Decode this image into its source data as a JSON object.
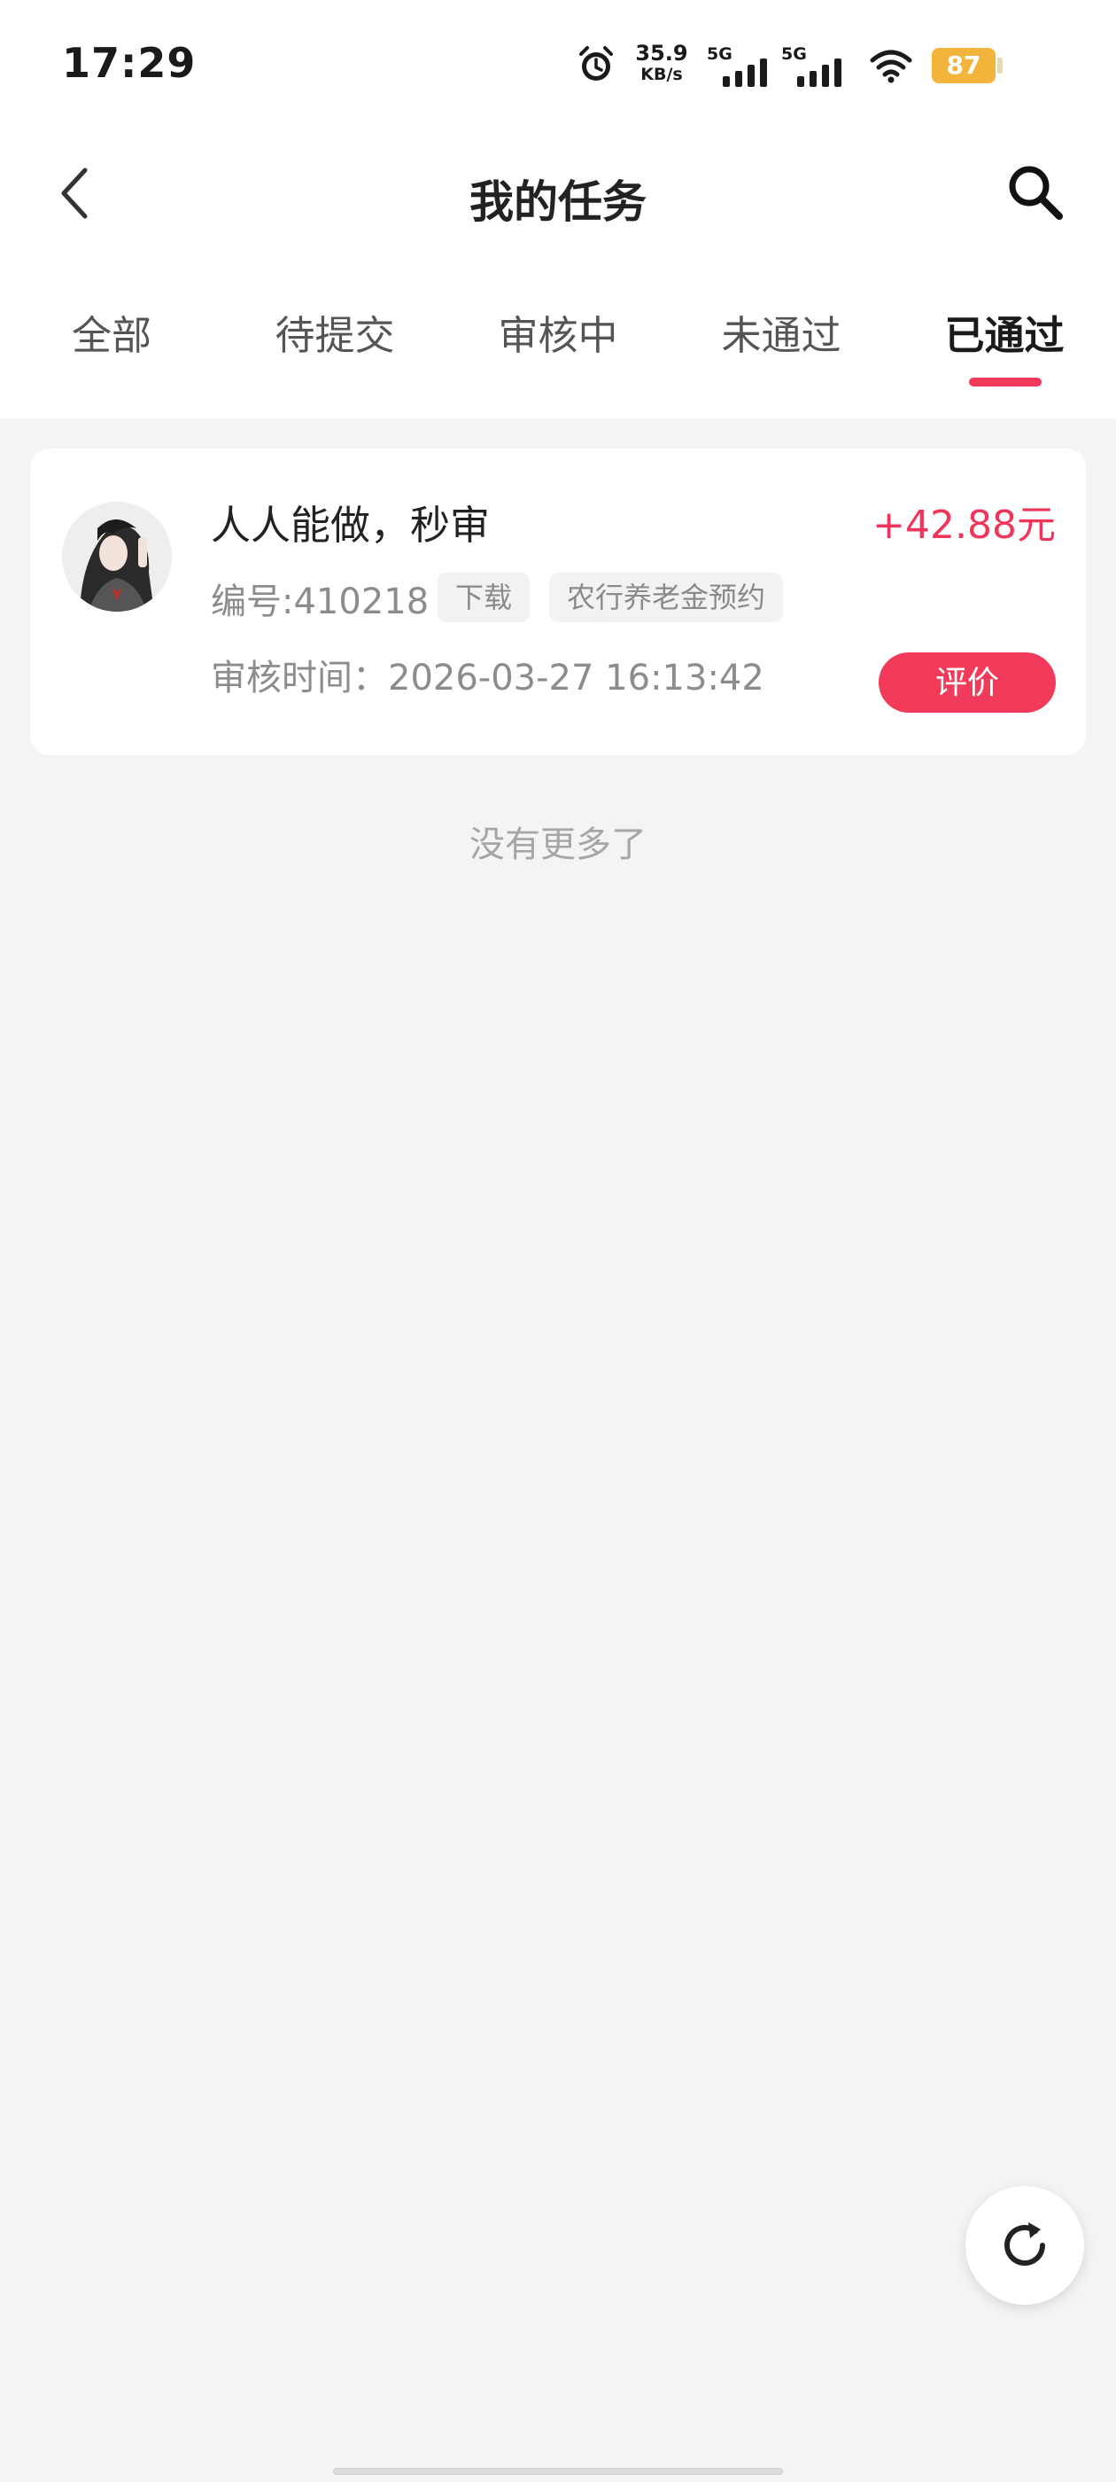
{
  "status_bar": {
    "time": "17:29",
    "net_speed_value": "35.9",
    "net_speed_unit": "KB/s",
    "signal_1_label": "5G",
    "signal_2_label": "5G",
    "battery": "87",
    "icons": [
      "alarm-icon",
      "signal-icon",
      "signal-icon",
      "wifi-icon",
      "battery-icon"
    ]
  },
  "nav": {
    "title": "我的任务",
    "icons": [
      "back-icon",
      "search-icon"
    ]
  },
  "tabs": [
    {
      "label": "全部"
    },
    {
      "label": "待提交"
    },
    {
      "label": "审核中"
    },
    {
      "label": "未通过"
    },
    {
      "label": "已通过",
      "active": true
    }
  ],
  "task": {
    "title": "人人能做，秒审",
    "reward": "+42.88元",
    "id": "编号:410218",
    "tags": [
      "下载",
      "农行养老金预约"
    ],
    "review_time": "审核时间：2026-03-27 16:13:42",
    "review_button": "评价"
  },
  "list_end_text": "没有更多了",
  "colors": {
    "accent": "#f23a5a",
    "reward": "#f0345a",
    "background": "#f4f4f4",
    "battery": "#f3b43c"
  },
  "fab_icon": "refresh-icon"
}
